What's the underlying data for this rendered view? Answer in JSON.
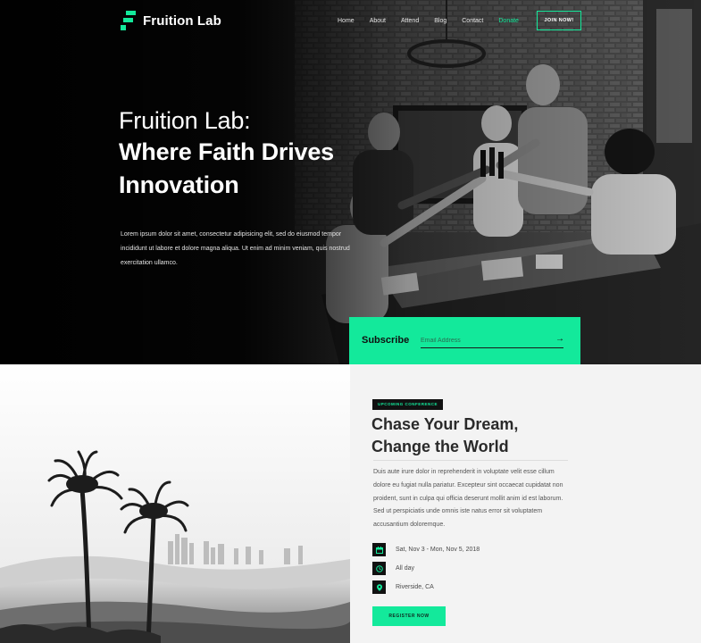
{
  "brand": {
    "name": "Fruition Lab",
    "accent_color": "#13e99b",
    "dark_color": "#111111"
  },
  "nav": {
    "items": [
      "Home",
      "About",
      "Attend",
      "Blog",
      "Contact",
      "Donate"
    ],
    "highlighted_item": "Donate",
    "join_label": "JOIN NOW!"
  },
  "hero": {
    "title_line1": "Fruition Lab:",
    "title_line2": "Where Faith Drives",
    "title_line3": "Innovation",
    "description": "Lorem ipsum dolor sit amet, consectetur adipisicing elit, sed do eiusmod tempor incididunt ut labore et dolore magna aliqua. Ut enim ad minim veniam, quis nostrud exercitation ullamco."
  },
  "subscribe": {
    "label": "Subscribe",
    "placeholder": "Email Address",
    "submit_icon": "arrow-right-icon"
  },
  "event": {
    "badge": "UPCOMING CONFERENCE",
    "title_line1": "Chase Your Dream,",
    "title_line2": "Change the World",
    "description": "Duis aute irure dolor in reprehenderit in voluptate velit esse cillum dolore eu fugiat nulla pariatur. Excepteur sint occaecat cupidatat non proident, sunt in culpa qui officia deserunt mollit anim id est laborum. Sed ut perspiciatis unde omnis iste natus error sit voluptatem accusantium doloremque.",
    "details": [
      {
        "icon": "calendar-icon",
        "text": "Sat, Nov 3 - Mon, Nov 5, 2018"
      },
      {
        "icon": "clock-icon",
        "text": "All day"
      },
      {
        "icon": "location-pin-icon",
        "text": "Riverside, CA"
      }
    ],
    "register_label": "REGISTER NOW"
  }
}
